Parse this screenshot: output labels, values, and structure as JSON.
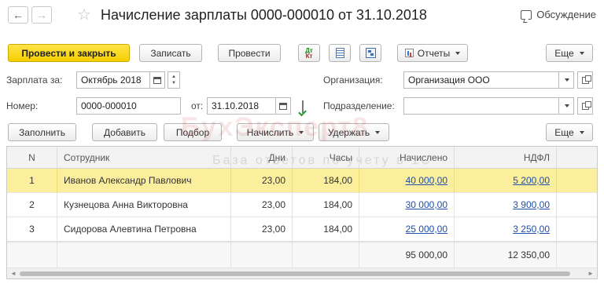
{
  "titlebar": {
    "title": "Начисление зарплаты 0000-000010 от 31.10.2018",
    "back_glyph": "←",
    "forward_glyph": "→",
    "star_glyph": "☆",
    "discuss_label": "Обсуждение"
  },
  "toolbar": {
    "post_and_close": "Провести и закрыть",
    "save": "Записать",
    "post": "Провести",
    "dtkt_top": "Дт",
    "dtkt_bottom": "Кт",
    "reports": "Отчеты",
    "more": "Еще"
  },
  "form": {
    "salary_for_label": "Зарплата за:",
    "salary_for_value": "Октябрь 2018",
    "number_label": "Номер:",
    "number_value": "0000-000010",
    "date_label": "от:",
    "date_value": "31.10.2018",
    "organization_label": "Организация:",
    "organization_value": "Организация ООО",
    "department_label": "Подразделение:",
    "department_value": ""
  },
  "table_toolbar": {
    "fill": "Заполнить",
    "add": "Добавить",
    "pick": "Подбор",
    "accrue": "Начислить",
    "withhold": "Удержать",
    "more": "Еще"
  },
  "watermark": {
    "line1": "БухЭксперт8",
    "line2": "База ответов по учету в 1С"
  },
  "table": {
    "columns": [
      "N",
      "Сотрудник",
      "Дни",
      "Часы",
      "Начислено",
      "НДФЛ"
    ],
    "rows": [
      {
        "n": "1",
        "employee": "Иванов Александр Павлович",
        "days": "23,00",
        "hours": "184,00",
        "accrued": "40 000,00",
        "ndfl": "5 200,00",
        "selected": true
      },
      {
        "n": "2",
        "employee": "Кузнецова Анна Викторовна",
        "days": "23,00",
        "hours": "184,00",
        "accrued": "30 000,00",
        "ndfl": "3 900,00",
        "selected": false
      },
      {
        "n": "3",
        "employee": "Сидорова Алевтина Петровна",
        "days": "23,00",
        "hours": "184,00",
        "accrued": "25 000,00",
        "ndfl": "3 250,00",
        "selected": false
      }
    ],
    "totals": {
      "accrued": "95 000,00",
      "ndfl": "12 350,00"
    }
  },
  "colors": {
    "primary_button": "#f5cf00",
    "selected_row": "#fbef9e",
    "link": "#1f4fa8"
  }
}
